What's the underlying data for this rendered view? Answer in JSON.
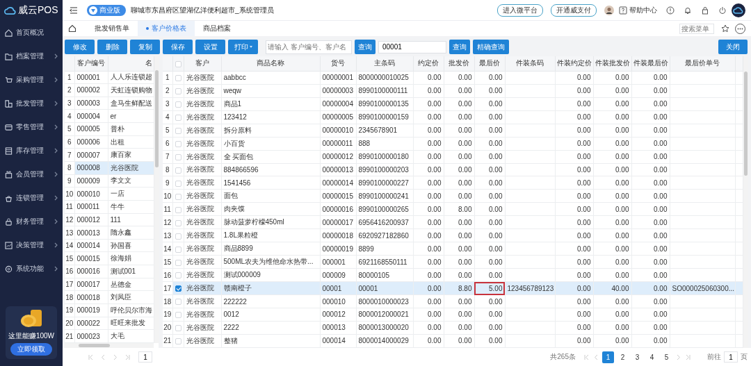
{
  "app": {
    "logo": "威云POS"
  },
  "sidebar": {
    "items": [
      {
        "label": "首页概况",
        "has_submenu": false
      },
      {
        "label": "档案管理",
        "has_submenu": true
      },
      {
        "label": "采购管理",
        "has_submenu": true
      },
      {
        "label": "批发管理",
        "has_submenu": true
      },
      {
        "label": "零售管理",
        "has_submenu": true
      },
      {
        "label": "库存管理",
        "has_submenu": true
      },
      {
        "label": "会员管理",
        "has_submenu": true
      },
      {
        "label": "连锁管理",
        "has_submenu": true
      },
      {
        "label": "财务管理",
        "has_submenu": true
      },
      {
        "label": "决策管理",
        "has_submenu": true
      },
      {
        "label": "系统功能",
        "has_submenu": true
      }
    ],
    "promo": {
      "text": "这里能赚100W",
      "button": "立即领取"
    }
  },
  "header": {
    "edition": "商业版",
    "store": "聊城市东昌府区望湖亿洋便利超市_系统管理员",
    "links": [
      "进入微平台",
      "开通威支付"
    ],
    "help": "帮助中心"
  },
  "tabs": [
    {
      "label": "批发销售单",
      "selected": false
    },
    {
      "label": "客户价格表",
      "selected": true
    },
    {
      "label": "商品档案",
      "selected": false
    }
  ],
  "menu_search": {
    "placeholder": "搜索菜单"
  },
  "toolbar": {
    "buttons": [
      {
        "label": "修改",
        "dropdown": false
      },
      {
        "label": "删除",
        "dropdown": false
      },
      {
        "label": "复制",
        "dropdown": false
      },
      {
        "label": "保存",
        "dropdown": false
      },
      {
        "label": "设置",
        "dropdown": false
      },
      {
        "label": "打印",
        "dropdown": true
      }
    ],
    "search": {
      "placeholder": "请输入 客户编号、客户名",
      "button": "查询"
    },
    "query": {
      "value": "00001",
      "buttons": [
        "查询",
        "精确查询"
      ]
    },
    "close_button": "关闭"
  },
  "customers": {
    "columns": [
      "客户编号",
      "名"
    ],
    "rows": [
      {
        "no": "1",
        "code": "000001",
        "name": "人人乐连锁超",
        "selected": false
      },
      {
        "no": "2",
        "code": "000002",
        "name": "天虹连锁购物",
        "selected": false
      },
      {
        "no": "3",
        "code": "000003",
        "name": "盒马生鲜配送",
        "selected": false
      },
      {
        "no": "4",
        "code": "000004",
        "name": "er",
        "selected": false
      },
      {
        "no": "5",
        "code": "000005",
        "name": "普朴",
        "selected": false
      },
      {
        "no": "6",
        "code": "000006",
        "name": "出租",
        "selected": false
      },
      {
        "no": "7",
        "code": "000007",
        "name": "康百家",
        "selected": false
      },
      {
        "no": "8",
        "code": "000008",
        "name": "光谷医院",
        "selected": true
      },
      {
        "no": "9",
        "code": "000009",
        "name": "李文文",
        "selected": false
      },
      {
        "no": "10",
        "code": "000010",
        "name": "一店",
        "selected": false
      },
      {
        "no": "11",
        "code": "000011",
        "name": "牛牛",
        "selected": false
      },
      {
        "no": "12",
        "code": "000012",
        "name": "111",
        "selected": false
      },
      {
        "no": "13",
        "code": "000013",
        "name": "隋永鑫",
        "selected": false
      },
      {
        "no": "14",
        "code": "000014",
        "name": "孙国喜",
        "selected": false
      },
      {
        "no": "15",
        "code": "000015",
        "name": "徐海娟",
        "selected": false
      },
      {
        "no": "16",
        "code": "000016",
        "name": "测试001",
        "selected": false
      },
      {
        "no": "17",
        "code": "000017",
        "name": "丛德金",
        "selected": false
      },
      {
        "no": "18",
        "code": "000018",
        "name": "刘凤臣",
        "selected": false
      },
      {
        "no": "19",
        "code": "000019",
        "name": "呼伦贝尔市海",
        "selected": false
      },
      {
        "no": "20",
        "code": "000022",
        "name": "旺旺来批发",
        "selected": false
      },
      {
        "no": "21",
        "code": "000023",
        "name": "大毛",
        "selected": false
      }
    ],
    "page": "1"
  },
  "prices": {
    "all_checked": false,
    "columns": [
      "客户",
      "商品名称",
      "货号",
      "主条码",
      "约定价",
      "批发价",
      "最后价",
      "件装条码",
      "件装约定价",
      "件装批发价",
      "件装最后价",
      "最后价单号"
    ],
    "rows": [
      {
        "no": "1",
        "checked": false,
        "selected": false,
        "customer": "光谷医院",
        "name": "aabbcc",
        "item_no": "00000001",
        "barcode": "8000000010025",
        "agreed": "0.00",
        "wholesale": "0.00",
        "last": "0.00",
        "last_flagged": false,
        "pack_agreed": "0.00",
        "pack_wholesale": "0.00",
        "pack_last": "0.00"
      },
      {
        "no": "2",
        "checked": false,
        "selected": false,
        "customer": "光谷医院",
        "name": "weqw",
        "item_no": "00000003",
        "barcode": "8990100000111",
        "agreed": "0.00",
        "wholesale": "0.00",
        "last": "0.00",
        "last_flagged": false,
        "pack_agreed": "0.00",
        "pack_wholesale": "0.00",
        "pack_last": "0.00"
      },
      {
        "no": "3",
        "checked": false,
        "selected": false,
        "customer": "光谷医院",
        "name": "商品1",
        "item_no": "00000004",
        "barcode": "8990100000135",
        "agreed": "0.00",
        "wholesale": "0.00",
        "last": "0.00",
        "last_flagged": false,
        "pack_agreed": "0.00",
        "pack_wholesale": "0.00",
        "pack_last": "0.00"
      },
      {
        "no": "4",
        "checked": false,
        "selected": false,
        "customer": "光谷医院",
        "name": "123412",
        "item_no": "00000005",
        "barcode": "8990100000159",
        "agreed": "0.00",
        "wholesale": "0.00",
        "last": "0.00",
        "last_flagged": false,
        "pack_agreed": "0.00",
        "pack_wholesale": "0.00",
        "pack_last": "0.00"
      },
      {
        "no": "5",
        "checked": false,
        "selected": false,
        "customer": "光谷医院",
        "name": "拆分原料",
        "item_no": "00000010",
        "barcode": "2345678901",
        "agreed": "0.00",
        "wholesale": "0.00",
        "last": "0.00",
        "last_flagged": false,
        "pack_agreed": "0.00",
        "pack_wholesale": "0.00",
        "pack_last": "0.00"
      },
      {
        "no": "6",
        "checked": false,
        "selected": false,
        "customer": "光谷医院",
        "name": "小百货",
        "item_no": "00000011",
        "barcode": "888",
        "agreed": "0.00",
        "wholesale": "0.00",
        "last": "0.00",
        "last_flagged": false,
        "pack_agreed": "0.00",
        "pack_wholesale": "0.00",
        "pack_last": "0.00"
      },
      {
        "no": "7",
        "checked": false,
        "selected": false,
        "customer": "光谷医院",
        "name": "全 买面包",
        "item_no": "00000012",
        "barcode": "8990100000180",
        "agreed": "0.00",
        "wholesale": "0.00",
        "last": "0.00",
        "last_flagged": false,
        "pack_agreed": "0.00",
        "pack_wholesale": "0.00",
        "pack_last": "0.00"
      },
      {
        "no": "8",
        "checked": false,
        "selected": false,
        "customer": "光谷医院",
        "name": "884866596",
        "item_no": "00000013",
        "barcode": "8990100000203",
        "agreed": "0.00",
        "wholesale": "0.00",
        "last": "0.00",
        "last_flagged": false,
        "pack_agreed": "0.00",
        "pack_wholesale": "0.00",
        "pack_last": "0.00"
      },
      {
        "no": "9",
        "checked": false,
        "selected": false,
        "customer": "光谷医院",
        "name": "1541456",
        "item_no": "00000014",
        "barcode": "8990100000227",
        "agreed": "0.00",
        "wholesale": "0.00",
        "last": "0.00",
        "last_flagged": false,
        "pack_agreed": "0.00",
        "pack_wholesale": "0.00",
        "pack_last": "0.00"
      },
      {
        "no": "10",
        "checked": false,
        "selected": false,
        "customer": "光谷医院",
        "name": "面包",
        "item_no": "00000015",
        "barcode": "8990100000241",
        "agreed": "0.00",
        "wholesale": "0.00",
        "last": "0.00",
        "last_flagged": false,
        "pack_agreed": "0.00",
        "pack_wholesale": "0.00",
        "pack_last": "0.00"
      },
      {
        "no": "11",
        "checked": false,
        "selected": false,
        "customer": "光谷医院",
        "name": "肉夹馍",
        "item_no": "00000016",
        "barcode": "8990100000265",
        "agreed": "0.00",
        "wholesale": "8.00",
        "last": "0.00",
        "last_flagged": false,
        "pack_agreed": "0.00",
        "pack_wholesale": "0.00",
        "pack_last": "0.00"
      },
      {
        "no": "12",
        "checked": false,
        "selected": false,
        "customer": "光谷医院",
        "name": "脉动菠萝柠檬450ml",
        "item_no": "00000017",
        "barcode": "6956416200937",
        "agreed": "0.00",
        "wholesale": "0.00",
        "last": "0.00",
        "last_flagged": false,
        "pack_agreed": "0.00",
        "pack_wholesale": "0.00",
        "pack_last": "0.00"
      },
      {
        "no": "13",
        "checked": false,
        "selected": false,
        "customer": "光谷医院",
        "name": "1.8L果粒橙",
        "item_no": "00000018",
        "barcode": "6920927182860",
        "agreed": "0.00",
        "wholesale": "0.00",
        "last": "0.00",
        "last_flagged": false,
        "pack_agreed": "0.00",
        "pack_wholesale": "0.00",
        "pack_last": "0.00"
      },
      {
        "no": "14",
        "checked": false,
        "selected": false,
        "customer": "光谷医院",
        "name": "商品8899",
        "item_no": "00000019",
        "barcode": "8899",
        "agreed": "0.00",
        "wholesale": "0.00",
        "last": "0.00",
        "last_flagged": false,
        "pack_agreed": "0.00",
        "pack_wholesale": "0.00",
        "pack_last": "0.00"
      },
      {
        "no": "15",
        "checked": false,
        "selected": false,
        "customer": "光谷医院",
        "name": "500ML农夫为维他命水热带...",
        "item_no": "000001",
        "barcode": "6921168550111",
        "agreed": "0.00",
        "wholesale": "0.00",
        "last": "0.00",
        "last_flagged": false,
        "pack_agreed": "0.00",
        "pack_wholesale": "0.00",
        "pack_last": "0.00"
      },
      {
        "no": "16",
        "checked": false,
        "selected": false,
        "customer": "光谷医院",
        "name": "测试000009",
        "item_no": "000009",
        "barcode": "80000105",
        "agreed": "0.00",
        "wholesale": "0.00",
        "last": "0.00",
        "last_flagged": false,
        "pack_agreed": "0.00",
        "pack_wholesale": "0.00",
        "pack_last": "0.00"
      },
      {
        "no": "17",
        "checked": true,
        "selected": true,
        "customer": "光谷医院",
        "name": "赣南橙子",
        "item_no": "00001",
        "barcode": "00001",
        "agreed": "0.00",
        "wholesale": "8.80",
        "last": "5.00",
        "last_flagged": true,
        "pack_barcode": "123456789123",
        "pack_agreed": "0.00",
        "pack_wholesale": "40.00",
        "pack_last": "0.00",
        "last_order_no": "SO000025060300..."
      },
      {
        "no": "18",
        "checked": false,
        "selected": false,
        "customer": "光谷医院",
        "name": "222222",
        "item_no": "000010",
        "barcode": "8000010000023",
        "agreed": "0.00",
        "wholesale": "0.00",
        "last": "0.00",
        "last_flagged": false,
        "pack_agreed": "0.00",
        "pack_wholesale": "0.00",
        "pack_last": "0.00"
      },
      {
        "no": "19",
        "checked": false,
        "selected": false,
        "customer": "光谷医院",
        "name": "0012",
        "item_no": "000012",
        "barcode": "8000012000021",
        "agreed": "0.00",
        "wholesale": "0.00",
        "last": "0.00",
        "last_flagged": false,
        "pack_agreed": "0.00",
        "pack_wholesale": "0.00",
        "pack_last": "0.00"
      },
      {
        "no": "20",
        "checked": false,
        "selected": false,
        "customer": "光谷医院",
        "name": "2222",
        "item_no": "000013",
        "barcode": "8000013000020",
        "agreed": "0.00",
        "wholesale": "0.00",
        "last": "0.00",
        "last_flagged": false,
        "pack_agreed": "0.00",
        "pack_wholesale": "0.00",
        "pack_last": "0.00"
      },
      {
        "no": "21",
        "checked": false,
        "selected": false,
        "customer": "光谷医院",
        "name": "整猪",
        "item_no": "000014",
        "barcode": "8000014000029",
        "agreed": "0.00",
        "wholesale": "0.00",
        "last": "0.00",
        "last_flagged": false,
        "pack_agreed": "0.00",
        "pack_wholesale": "0.00",
        "pack_last": "0.00"
      }
    ]
  },
  "pagination": {
    "total": "共265条",
    "pages": [
      {
        "label": "1",
        "selected": true
      },
      {
        "label": "2",
        "selected": false
      },
      {
        "label": "3",
        "selected": false
      },
      {
        "label": "4",
        "selected": false
      },
      {
        "label": "5",
        "selected": false
      }
    ],
    "goto_label": "前往",
    "page": "1",
    "unit": "页"
  }
}
